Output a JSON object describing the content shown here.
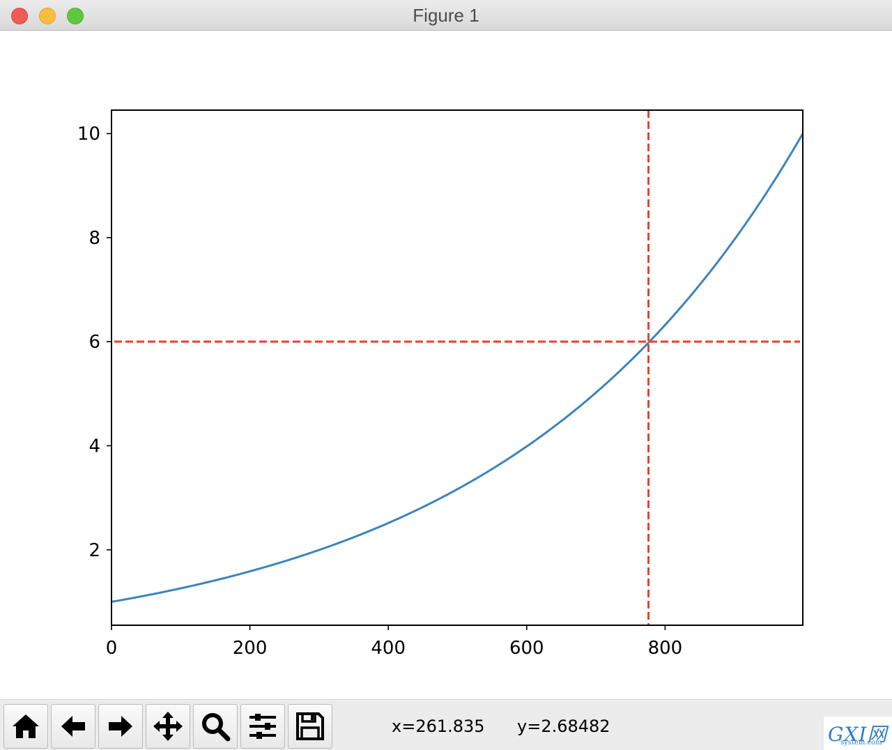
{
  "window": {
    "title": "Figure 1"
  },
  "toolbar": {
    "buttons": [
      {
        "name": "home",
        "icon": "home-icon"
      },
      {
        "name": "back",
        "icon": "arrow-left-icon"
      },
      {
        "name": "forward",
        "icon": "arrow-right-icon"
      },
      {
        "name": "pan",
        "icon": "move-icon"
      },
      {
        "name": "zoom",
        "icon": "magnifier-icon"
      },
      {
        "name": "configure-subplots",
        "icon": "sliders-icon"
      },
      {
        "name": "save",
        "icon": "floppy-disk-icon"
      }
    ],
    "x_readout": "x=261.835",
    "y_readout": "y=2.68482"
  },
  "watermark": {
    "text": "GXI网",
    "subtext": "system.com"
  },
  "chart_data": {
    "type": "line",
    "title": "",
    "xlabel": "",
    "ylabel": "",
    "xlim": [
      0,
      999
    ],
    "ylim": [
      0.55,
      10.45
    ],
    "xticks": [
      0,
      200,
      400,
      600,
      800
    ],
    "yticks": [
      2,
      4,
      6,
      8,
      10
    ],
    "xtick_labels": [
      "0",
      "200",
      "400",
      "600",
      "800"
    ],
    "ytick_labels": [
      "2",
      "4",
      "6",
      "8",
      "10"
    ],
    "grid": false,
    "series": [
      {
        "color": "#3b84bc",
        "x": [
          0,
          100,
          200,
          300,
          400,
          500,
          600,
          700,
          776,
          800,
          900,
          999
        ],
        "y": [
          1.0,
          1.26,
          1.59,
          2.0,
          2.51,
          3.16,
          3.98,
          5.01,
          6.0,
          6.31,
          7.94,
          10.0
        ]
      }
    ],
    "reference_lines": [
      {
        "orientation": "vertical",
        "value": 776,
        "color": "#e8402a",
        "style": "dashed"
      },
      {
        "orientation": "horizontal",
        "value": 6,
        "color": "#e8402a",
        "style": "dashed"
      }
    ]
  }
}
